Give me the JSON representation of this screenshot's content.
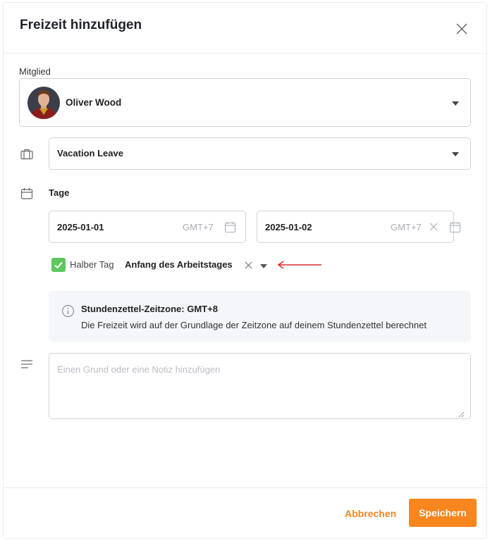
{
  "dialog": {
    "title": "Freizeit hinzufügen"
  },
  "member": {
    "label": "Mitglied",
    "name": "Oliver Wood"
  },
  "leave_type": {
    "value": "Vacation Leave"
  },
  "days": {
    "label": "Tage",
    "start_date": "2025-01-01",
    "start_tz": "GMT+7",
    "end_date": "2025-01-02",
    "end_tz": "GMT+7"
  },
  "half_day": {
    "checked": true,
    "label": "Halber Tag",
    "value": "Anfang des Arbeitstages"
  },
  "info": {
    "title": "Stundenzettel-Zeitzone: GMT+8",
    "text": "Die Freizeit wird auf der Grundlage der Zeitzone auf deinem Stundenzettel berechnet"
  },
  "note": {
    "placeholder": "Einen Grund oder eine Notiz hinzufügen",
    "value": ""
  },
  "footer": {
    "cancel_label": "Abbrechen",
    "save_label": "Speichern"
  },
  "colors": {
    "accent": "#f7861f",
    "checkbox": "#5cc85e",
    "annotation_arrow": "#d92b2b",
    "info_bg": "#f4f6fa"
  },
  "icons": {
    "close": "close-icon",
    "leave_type": "briefcase-icon",
    "days": "calendar-icon",
    "note": "lines-icon",
    "info": "info-icon",
    "dropdown": "caret-down-icon"
  }
}
